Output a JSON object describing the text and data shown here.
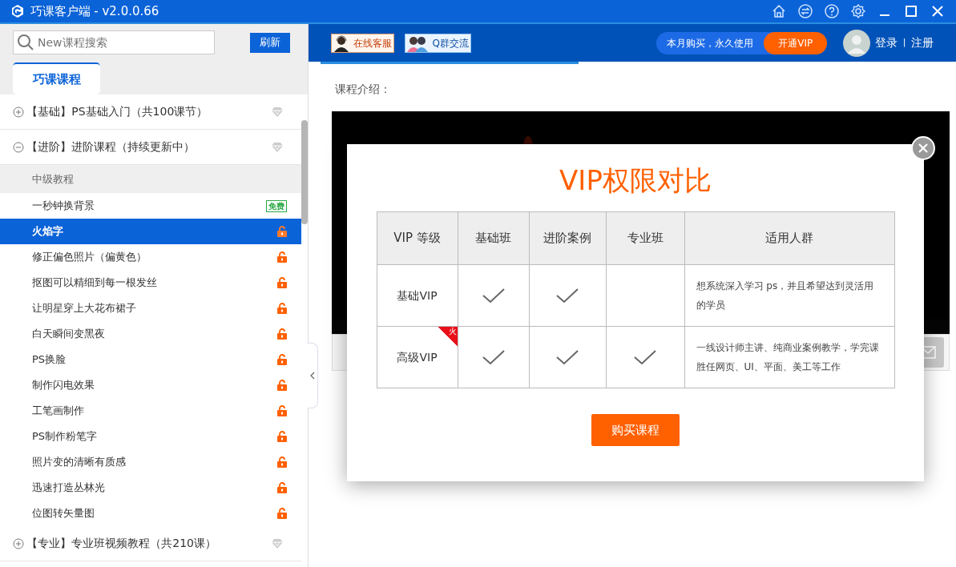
{
  "window": {
    "title": "巧课客户端 - v2.0.0.66"
  },
  "sidebar": {
    "search": {
      "placeholder": "New课程搜索"
    },
    "refresh_button": "刷新",
    "tabs": [
      {
        "label": "巧课课程",
        "selected": true
      }
    ],
    "groups": [
      {
        "title": "【基础】PS基础入门（共100课节）",
        "expanded": false
      },
      {
        "title": "【进阶】进阶课程（持续更新中）",
        "expanded": true,
        "sections": [
          {
            "title": "中级教程",
            "lessons": [
              {
                "title": "一秒钟换背景",
                "locked": false,
                "badge": "免费",
                "selected": false
              },
              {
                "title": "火焰字",
                "locked": true,
                "selected": true
              },
              {
                "title": "修正偏色照片（偏黄色）",
                "locked": true,
                "selected": false
              },
              {
                "title": "抠图可以精细到每一根发丝",
                "locked": true,
                "selected": false
              },
              {
                "title": "让明星穿上大花布裙子",
                "locked": true,
                "selected": false
              },
              {
                "title": "白天瞬间变黑夜",
                "locked": true,
                "selected": false
              },
              {
                "title": "PS换脸",
                "locked": true,
                "selected": false
              },
              {
                "title": "制作闪电效果",
                "locked": true,
                "selected": false
              },
              {
                "title": "工笔画制作",
                "locked": true,
                "selected": false
              },
              {
                "title": "PS制作粉笔字",
                "locked": true,
                "selected": false
              },
              {
                "title": "照片变的清晰有质感",
                "locked": true,
                "selected": false
              },
              {
                "title": "迅速打造丛林光",
                "locked": true,
                "selected": false
              },
              {
                "title": "位图转矢量图",
                "locked": true,
                "selected": false
              }
            ]
          }
        ]
      },
      {
        "title": "【专业】专业班视频教程（共210课）",
        "expanded": false
      }
    ]
  },
  "header": {
    "links": [
      {
        "label": "在线客服",
        "kind": "service"
      },
      {
        "label": "Q群交流",
        "kind": "group"
      }
    ],
    "promo": {
      "text": "本月购买，永久使用",
      "button": "开通VIP"
    },
    "account": {
      "login": "登录",
      "separator": "|",
      "register": "注册"
    }
  },
  "content": {
    "intro_label": "课程介绍："
  },
  "vip_dialog": {
    "title": "VIP权限对比",
    "columns": [
      "VIP 等级",
      "基础班",
      "进阶案例",
      "专业班",
      "适用人群"
    ],
    "rows": [
      {
        "level": "基础VIP",
        "hot": false,
        "checks": [
          true,
          true,
          false
        ],
        "audience": "想系统深入学习 ps，并且希望达到灵活用的学员"
      },
      {
        "level": "高级VIP",
        "hot": true,
        "hot_label": "火",
        "checks": [
          true,
          true,
          true
        ],
        "audience": "一线设计师主讲、纯商业案例教学，学完课胜任网页、UI、平面、美工等工作"
      }
    ],
    "buy_button": "购买课程"
  }
}
